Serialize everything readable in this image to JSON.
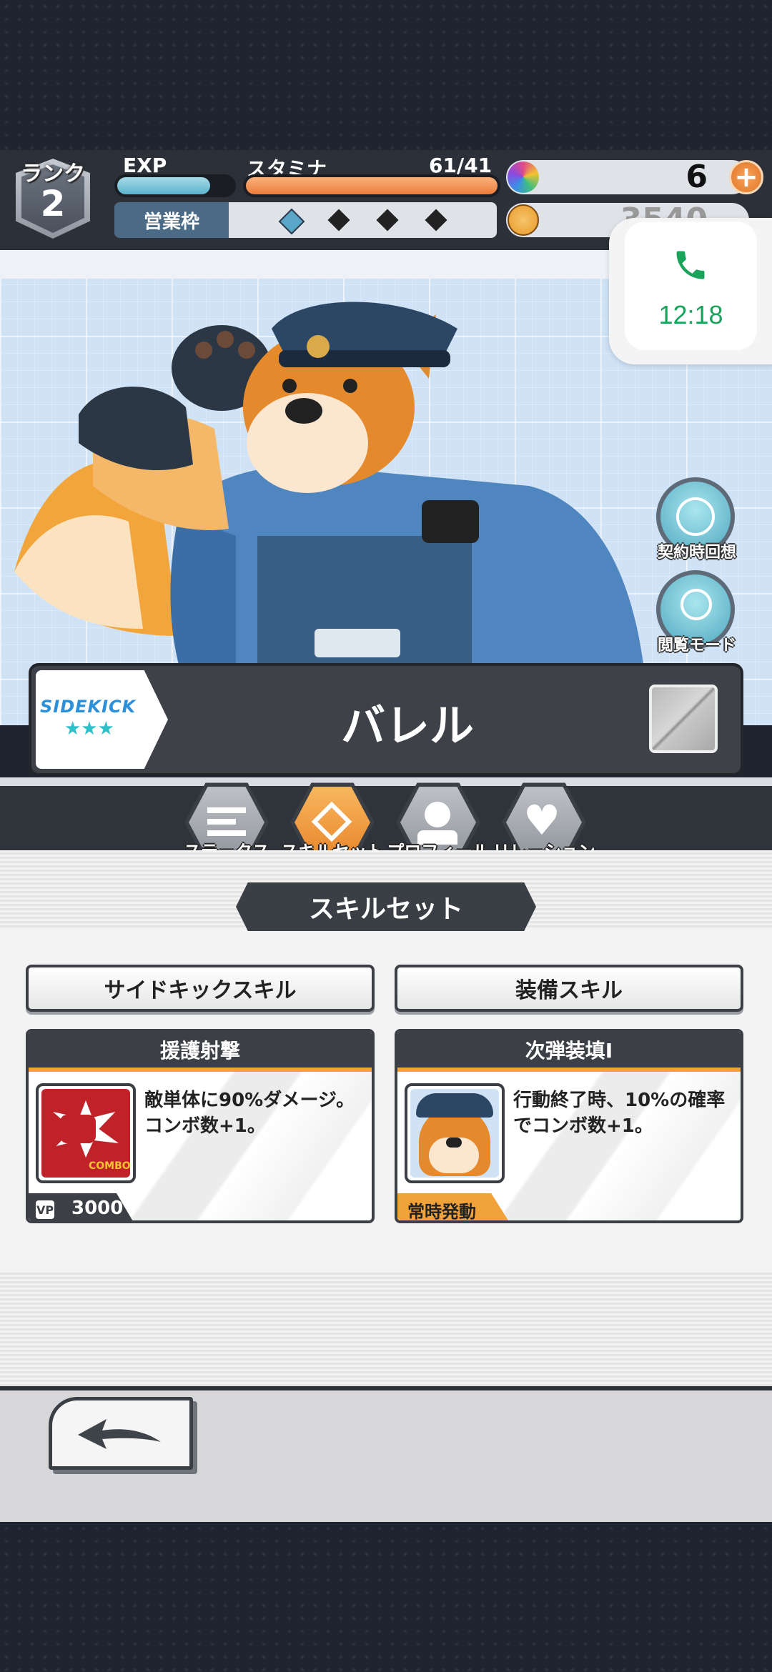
{
  "header": {
    "rank_label": "ランク",
    "rank_value": "2",
    "exp_label": "EXP",
    "exp_progress": 0.8,
    "stamina_label": "スタミナ",
    "stamina_value": "61/41",
    "stamina_progress": 1.0,
    "eigyo_label": "営業枠",
    "gem_count": "6",
    "coin_count": "3540"
  },
  "call": {
    "time": "12:18",
    "icon": "phone-icon"
  },
  "side_buttons": [
    {
      "label": "契約時回想",
      "icon": "globe-icon"
    },
    {
      "label": "閲覧モード",
      "icon": "person-search-icon"
    }
  ],
  "character": {
    "badge": "SIDEKICK",
    "stars": "★★★",
    "name": "バレル"
  },
  "tabs": [
    {
      "label": "ステータス",
      "icon": "status-icon",
      "active": false
    },
    {
      "label": "スキルセット",
      "icon": "skillset-icon",
      "active": true
    },
    {
      "label": "プロフィール",
      "icon": "profile-icon",
      "active": false
    },
    {
      "label": "リレーション",
      "icon": "heart-icon",
      "active": false
    }
  ],
  "section_title": "スキルセット",
  "skills": {
    "sidekick_button": "サイドキックスキル",
    "equip_button": "装備スキル",
    "sidekick_card": {
      "title": "援護射撃",
      "description": "敵単体に90%ダメージ。コンボ数+1。",
      "vp_label": "VP",
      "cost": "3000",
      "icon_text": "COMBO"
    },
    "equip_card": {
      "title": "次弾装填Ⅰ",
      "description": "行動終了時、10%の確率でコンボ数+1。",
      "footer": "常時発動"
    }
  },
  "colors": {
    "accent_orange": "#f2a23a",
    "dark_panel": "#3c3f45",
    "call_green": "#1aa35a"
  }
}
